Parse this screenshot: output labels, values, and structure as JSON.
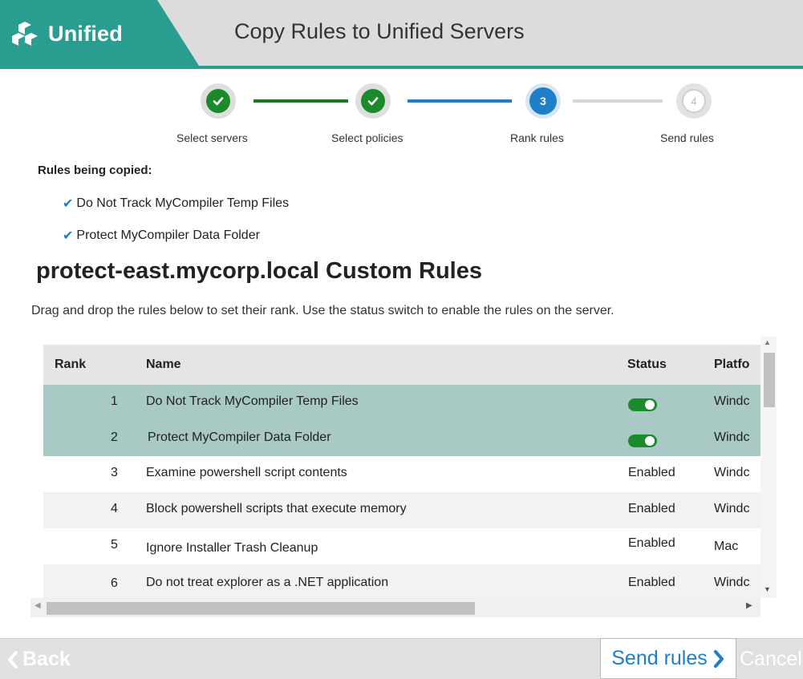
{
  "header": {
    "brand": "Unified",
    "title": "Copy Rules to Unified Servers",
    "brand_color": "#2a9d91"
  },
  "stepper": {
    "steps": [
      {
        "label": "Select servers",
        "state": "done",
        "number": ""
      },
      {
        "label": "Select policies",
        "state": "done",
        "number": ""
      },
      {
        "label": "Rank rules",
        "state": "active",
        "number": "3"
      },
      {
        "label": "Send rules",
        "state": "future",
        "number": "4"
      }
    ],
    "done_color": "#1b8a2a",
    "active_color": "#1e7ec7"
  },
  "copied": {
    "title": "Rules being copied:",
    "items": [
      "Do Not Track MyCompiler Temp Files",
      "Protect MyCompiler Data Folder"
    ]
  },
  "server_title": "protect-east.mycorp.local Custom Rules",
  "instructions": "Drag and drop the rules below to set their rank. Use the status switch to enable the rules on the server.",
  "table": {
    "headers": {
      "rank": "Rank",
      "name": "Name",
      "status": "Status",
      "platform": "Platfo"
    },
    "rows": [
      {
        "rank": "1",
        "name": "Do Not Track MyCompiler Temp Files",
        "status": "",
        "platform": "Windc"
      },
      {
        "rank": "2",
        "name": "Protect MyCompiler Data Folder",
        "status": "",
        "platform": "Windc"
      },
      {
        "rank": "3",
        "name": "Examine powershell script contents",
        "status": "Enabled",
        "platform": "Windc"
      },
      {
        "rank": "4",
        "name": "Block powershell scripts that execute memory",
        "status": "Enabled",
        "platform": "Windc"
      },
      {
        "rank": "5",
        "name": "Ignore Installer Trash Cleanup",
        "status": "Enabled",
        "platform": "Mac"
      },
      {
        "rank": "6",
        "name": "Do not treat explorer as a .NET application",
        "status": "Enabled",
        "platform": "Windc"
      }
    ]
  },
  "footer": {
    "back": "Back",
    "send": "Send rules",
    "cancel": "Cancel"
  }
}
